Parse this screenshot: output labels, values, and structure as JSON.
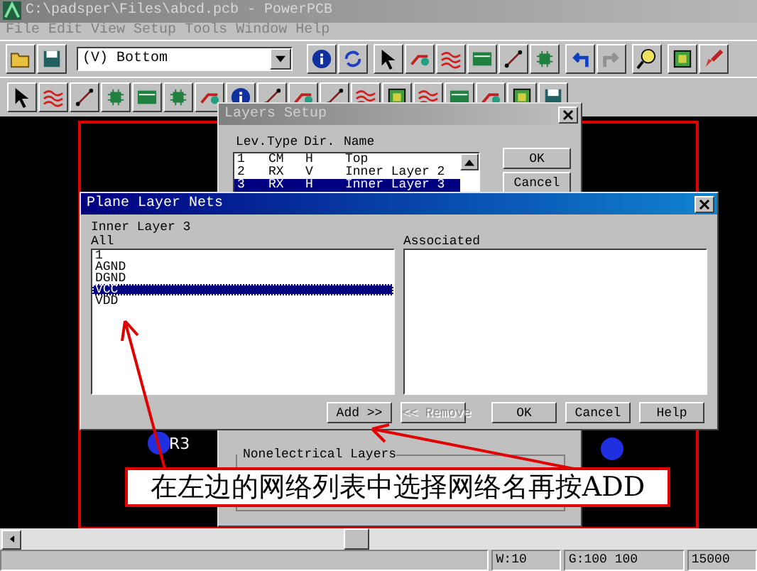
{
  "window": {
    "title": "C:\\padsper\\Files\\abcd.pcb - PowerPCB"
  },
  "menu": [
    "File",
    "Edit",
    "View",
    "Setup",
    "Tools",
    "Window",
    "Help"
  ],
  "toolbar": {
    "layer_combo": "(V) Bottom"
  },
  "canvas": {
    "component_label": "R3"
  },
  "layers_dialog": {
    "title": "Layers Setup",
    "columns": [
      "Lev.",
      "Type",
      "Dir.",
      "Name"
    ],
    "rows": [
      {
        "lev": "1",
        "type": "CM",
        "dir": "H",
        "name": "Top",
        "selected": false
      },
      {
        "lev": "2",
        "type": "RX",
        "dir": "V",
        "name": "Inner Layer 2",
        "selected": false
      },
      {
        "lev": "3",
        "type": "RX",
        "dir": "H",
        "name": "Inner Layer 3",
        "selected": true
      }
    ],
    "buttons": [
      "OK",
      "Cancel"
    ],
    "group_label": "Nonelectrical Layers"
  },
  "plane_dialog": {
    "title": "Plane Layer Nets",
    "layer": "Inner Layer 3",
    "all_label": "All",
    "associated_label": "Associated",
    "nets": [
      {
        "name": "1",
        "selected": false
      },
      {
        "name": "AGND",
        "selected": false
      },
      {
        "name": "DGND",
        "selected": false
      },
      {
        "name": "VCC",
        "selected": true
      },
      {
        "name": "VDD",
        "selected": false
      }
    ],
    "buttons": [
      {
        "label": "Add >>",
        "disabled": false
      },
      {
        "label": "<< Remove",
        "disabled": true
      },
      {
        "label": "OK",
        "disabled": false
      },
      {
        "label": "Cancel",
        "disabled": false
      },
      {
        "label": "Help",
        "disabled": false
      }
    ]
  },
  "annotation": "在左边的网络列表中选择网络名再按ADD",
  "status_bar": [
    "W:10",
    "G:100 100",
    "15000"
  ]
}
